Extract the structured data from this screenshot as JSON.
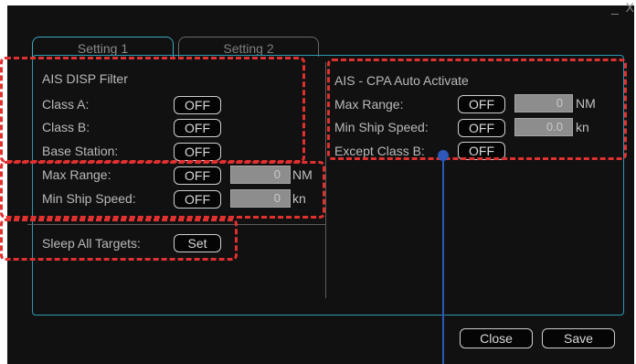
{
  "window": {
    "controls": "_ X"
  },
  "tabs": [
    {
      "label": "Setting 1"
    },
    {
      "label": "Setting 2"
    }
  ],
  "ais_disp_filter": {
    "title": "AIS DISP Filter",
    "class_a": {
      "label": "Class A:",
      "button": "OFF"
    },
    "class_b": {
      "label": "Class B:",
      "button": "OFF"
    },
    "base_station": {
      "label": "Base Station:",
      "button": "OFF"
    }
  },
  "range_filter": {
    "max_range": {
      "label": "Max Range:",
      "button": "OFF",
      "value": "0",
      "unit": "NM"
    },
    "min_ship_speed": {
      "label": "Min Ship Speed:",
      "button": "OFF",
      "value": "0",
      "unit": "kn"
    }
  },
  "sleep": {
    "label": "Sleep All Targets:",
    "button": "Set"
  },
  "cpa_auto": {
    "title": "AIS - CPA Auto Activate",
    "max_range": {
      "label": "Max Range:",
      "button": "OFF",
      "value": "0",
      "unit": "NM"
    },
    "min_ship_speed": {
      "label": "Min Ship Speed:",
      "button": "OFF",
      "value": "0.0",
      "unit": "kn"
    },
    "except_class_b": {
      "label": "Except Class B:",
      "button": "OFF"
    }
  },
  "footer": {
    "close": "Close",
    "save": "Save"
  },
  "colors": {
    "background": "#111111",
    "panel_border": "#2c97b0",
    "highlight": "#e03030",
    "callout": "#2d58b8"
  }
}
